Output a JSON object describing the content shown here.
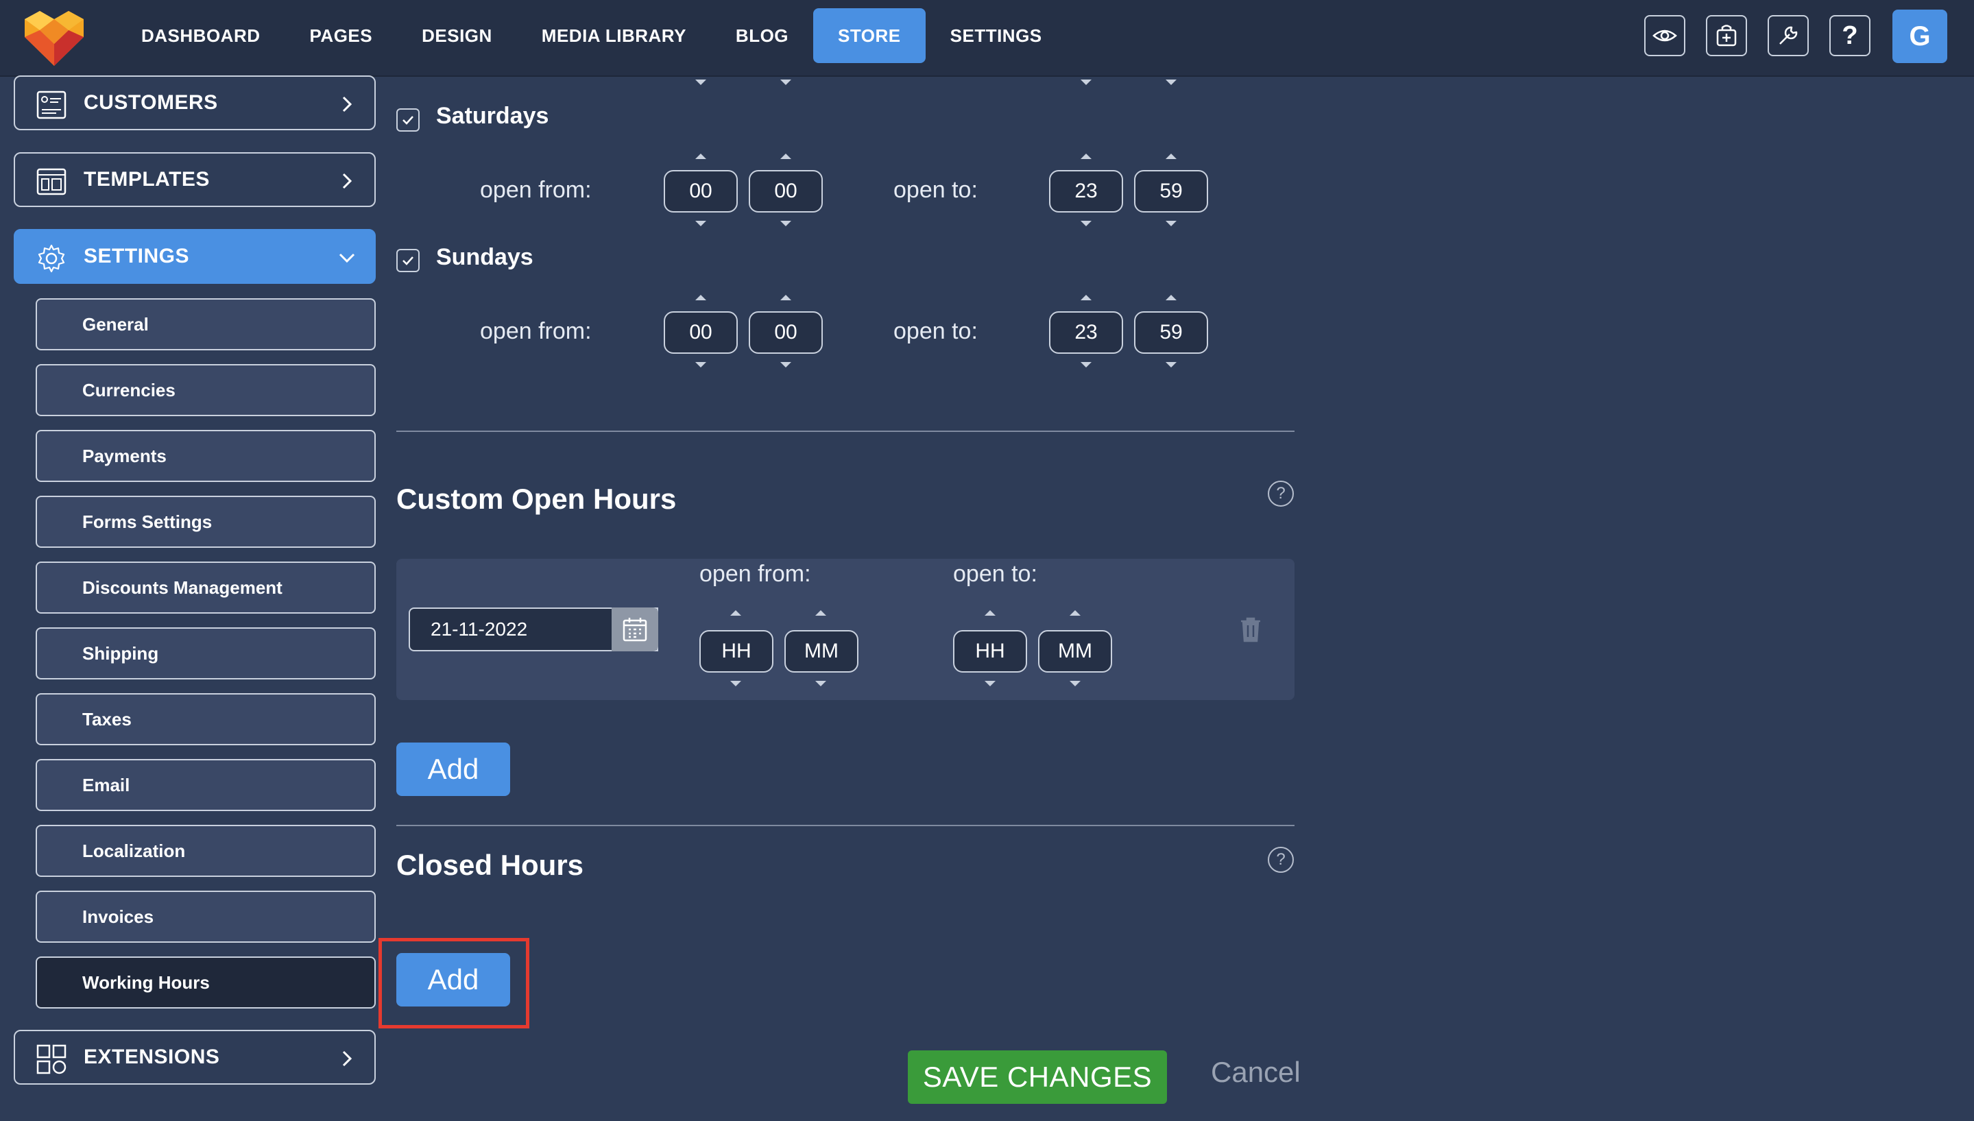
{
  "nav": {
    "items": [
      "DASHBOARD",
      "PAGES",
      "DESIGN",
      "MEDIA LIBRARY",
      "BLOG",
      "STORE",
      "SETTINGS"
    ],
    "active": "STORE"
  },
  "toolbar": {
    "icons": [
      "eye-icon",
      "store-add-icon",
      "wrench-icon",
      "help-icon"
    ],
    "help_glyph": "?",
    "avatar_initial": "G"
  },
  "sidebar": {
    "customers": "CUSTOMERS",
    "templates": "TEMPLATES",
    "settings": "SETTINGS",
    "extensions": "EXTENSIONS",
    "sub_items": [
      "General",
      "Currencies",
      "Payments",
      "Forms Settings",
      "Discounts Management",
      "Shipping",
      "Taxes",
      "Email",
      "Localization",
      "Invoices",
      "Working Hours"
    ],
    "active_sub": "Working Hours"
  },
  "working_hours": {
    "open_from_label": "open from:",
    "open_to_label": "open to:",
    "days": [
      {
        "name": "Saturdays",
        "checked": true,
        "from_h": "00",
        "from_m": "00",
        "to_h": "23",
        "to_m": "59"
      },
      {
        "name": "Sundays",
        "checked": true,
        "from_h": "00",
        "from_m": "00",
        "to_h": "23",
        "to_m": "59"
      }
    ]
  },
  "custom_open_hours": {
    "title": "Custom Open Hours",
    "help": "?",
    "entry": {
      "date": "21-11-2022",
      "open_from_label": "open from:",
      "open_to_label": "open to:",
      "from_h_placeholder": "HH",
      "from_m_placeholder": "MM",
      "to_h_placeholder": "HH",
      "to_m_placeholder": "MM"
    },
    "add_label": "Add"
  },
  "closed_hours": {
    "title": "Closed Hours",
    "help": "?",
    "add_label": "Add"
  },
  "footer": {
    "save_label": "SAVE CHANGES",
    "cancel_label": "Cancel"
  },
  "colors": {
    "accent": "#4a90e2",
    "save": "#3a9b3a",
    "highlight": "#e53a2f",
    "background": "#2e3c57"
  }
}
